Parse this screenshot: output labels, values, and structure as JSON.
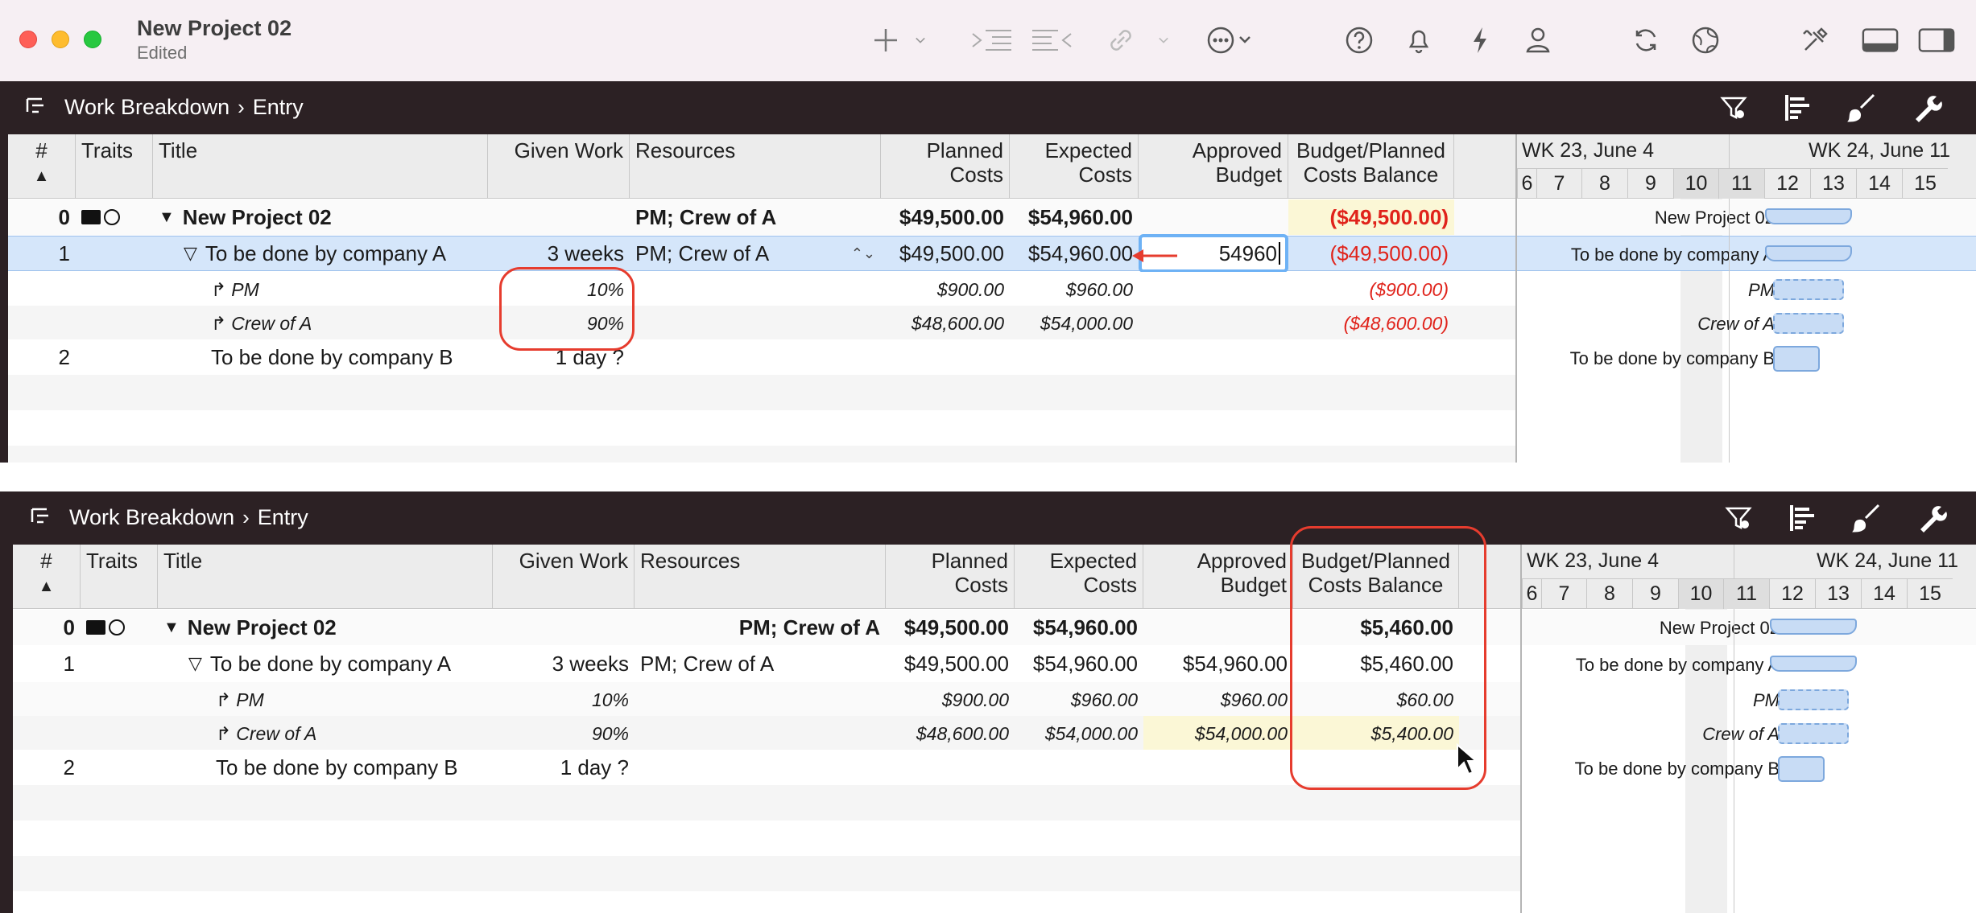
{
  "window": {
    "title": "New Project 02",
    "subtitle": "Edited"
  },
  "toolbar_icons": [
    "plus-icon",
    "chevron-down-icon",
    "indent-icon",
    "outdent-icon",
    "link-icon",
    "chevron-down-icon",
    "ellipsis-circle-icon",
    "help-icon",
    "bell-icon",
    "lightning-icon",
    "person-icon",
    "refresh-icon",
    "globe-icon",
    "tools-icon",
    "bottom-panel-icon",
    "side-panel-icon"
  ],
  "pane_top": {
    "breadcrumb": [
      "Work Breakdown",
      "Entry"
    ]
  },
  "pane_bottom": {
    "breadcrumb": [
      "Work Breakdown",
      "Entry"
    ]
  },
  "columns": {
    "num": "#",
    "traits": "Traits",
    "title": "Title",
    "given_work": "Given Work",
    "resources": "Resources",
    "planned": [
      "Planned",
      "Costs"
    ],
    "expected": [
      "Expected",
      "Costs"
    ],
    "approved": [
      "Approved",
      "Budget"
    ],
    "balance": [
      "Budget/Planned",
      "Costs Balance"
    ]
  },
  "gantt": {
    "week1": "WK 23, June 4",
    "week2": "WK 24, June 11",
    "days": [
      "6",
      "7",
      "8",
      "9",
      "10",
      "11",
      "12",
      "13",
      "14",
      "15"
    ]
  },
  "top_rows": [
    {
      "num": "0",
      "title": "New Project 02",
      "given": "",
      "resources": "PM; Crew of A",
      "planned": "$49,500.00",
      "expected": "$54,960.00",
      "approved": "",
      "balance": "($49,500.00)",
      "gantt_label": "New Project 02"
    },
    {
      "num": "1",
      "title": "To be done by company A",
      "given": "3 weeks",
      "resources": "PM; Crew of A",
      "planned": "$49,500.00",
      "expected": "$54,960.00",
      "approved": "54960",
      "balance": "($49,500.00)",
      "gantt_label": "To be done by company A"
    },
    {
      "num": "",
      "title": "PM",
      "given": "10%",
      "resources": "",
      "planned": "$900.00",
      "expected": "$960.00",
      "approved": "",
      "balance": "($900.00)",
      "gantt_label": "PM"
    },
    {
      "num": "",
      "title": "Crew of A",
      "given": "90%",
      "resources": "",
      "planned": "$48,600.00",
      "expected": "$54,000.00",
      "approved": "",
      "balance": "($48,600.00)",
      "gantt_label": "Crew of A"
    },
    {
      "num": "2",
      "title": "To be done by company B",
      "given": "1 day ?",
      "resources": "",
      "planned": "",
      "expected": "",
      "approved": "",
      "balance": "",
      "gantt_label": "To be done by company B"
    }
  ],
  "bottom_rows": [
    {
      "num": "0",
      "title": "New Project 02",
      "given": "",
      "resources": "PM; Crew of A",
      "planned": "$49,500.00",
      "expected": "$54,960.00",
      "approved": "",
      "balance": "$5,460.00",
      "gantt_label": "New Project 02"
    },
    {
      "num": "1",
      "title": "To be done by company A",
      "given": "3 weeks",
      "resources": "PM; Crew of A",
      "planned": "$49,500.00",
      "expected": "$54,960.00",
      "approved": "$54,960.00",
      "balance": "$5,460.00",
      "gantt_label": "To be done by company A"
    },
    {
      "num": "",
      "title": "PM",
      "given": "10%",
      "resources": "",
      "planned": "$900.00",
      "expected": "$960.00",
      "approved": "$960.00",
      "balance": "$60.00",
      "gantt_label": "PM"
    },
    {
      "num": "",
      "title": "Crew of A",
      "given": "90%",
      "resources": "",
      "planned": "$48,600.00",
      "expected": "$54,000.00",
      "approved": "$54,000.00",
      "balance": "$5,400.00",
      "gantt_label": "Crew of A"
    },
    {
      "num": "2",
      "title": "To be done by company B",
      "given": "1 day ?",
      "resources": "",
      "planned": "",
      "expected": "",
      "approved": "",
      "balance": "",
      "gantt_label": "To be done by company B"
    }
  ],
  "colors": {
    "titlebar": "#f6eff3",
    "pane_bar": "#2c2124",
    "selected_row": "#d5e6fa",
    "negative": "#e0231b",
    "highlight": "#fbf7d6",
    "annotation": "#e63c2e",
    "gantt_bar": "#c8dcf5"
  }
}
